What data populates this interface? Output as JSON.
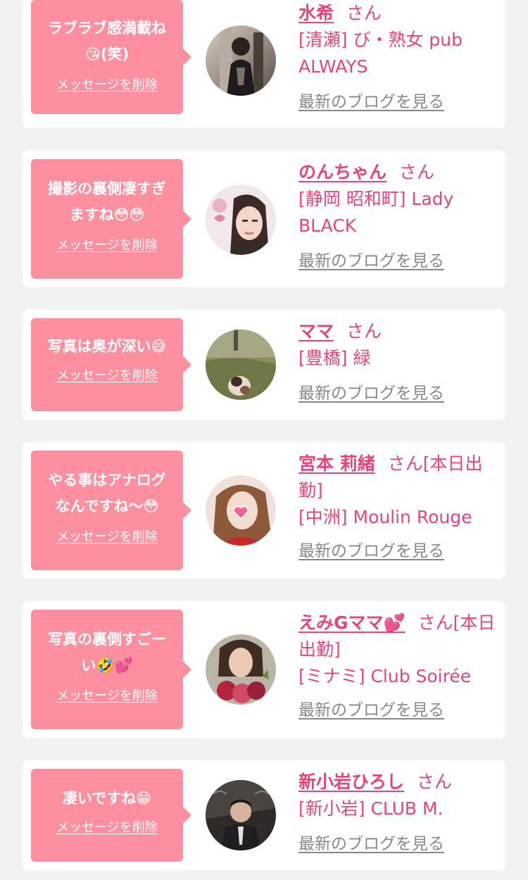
{
  "delete_label": "メッセージを削除",
  "blog_label": "最新のブログを見る",
  "honorific": "さん",
  "colors": {
    "background": "#f2f2f2",
    "card": "#ffffff",
    "bubble": "#fd8f9e",
    "accent": "#e8437a",
    "link_gray": "#888888"
  },
  "messages": [
    {
      "bubble_line1": "ラブラブ感満載ね",
      "bubble_line2": "😘(笑)",
      "name": "水希",
      "status": "",
      "shop": "[清瀬] び・熟女 pub ALWAYS"
    },
    {
      "bubble_line1": "撮影の裏側凄すぎ",
      "bubble_line2": "ますね😳😳",
      "name": "のんちゃん",
      "status": "",
      "shop": "[静岡 昭和町] Lady BLACK"
    },
    {
      "bubble_line1": "写真は奥が深い😅",
      "bubble_line2": "",
      "name": "ママ",
      "status": "",
      "shop": "[豊橋] 緑"
    },
    {
      "bubble_line1": "やる事はアナログ",
      "bubble_line2": "なんですね〜😳",
      "name": "宮本 莉緒",
      "status": "[本日出勤]",
      "shop": "[中洲] Moulin Rouge"
    },
    {
      "bubble_line1": "写真の裏側すごー",
      "bubble_line2": "い🤣💕",
      "name": "えみGママ💕",
      "status": "[本日出勤]",
      "shop": "[ミナミ] Club Soirée"
    },
    {
      "bubble_line1": "凄いですね😁",
      "bubble_line2": "",
      "name": "新小岩ひろし",
      "status": "",
      "shop": "[新小岩] CLUB M."
    }
  ]
}
